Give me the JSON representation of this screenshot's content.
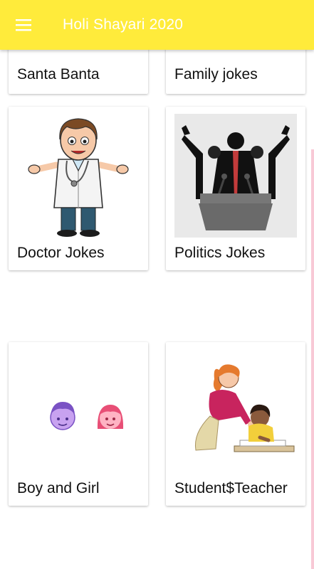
{
  "app": {
    "title": "Holi Shayari 2020",
    "accent_color": "#ffeb3b"
  },
  "toolbar": {
    "menu_icon": "hamburger-menu-icon"
  },
  "categories": [
    {
      "label": "Santa Banta",
      "icon": "none"
    },
    {
      "label": "Family jokes",
      "icon": "none"
    },
    {
      "label": "Doctor Jokes",
      "icon": "doctor-cartoon-icon"
    },
    {
      "label": "Politics Jokes",
      "icon": "politician-podium-icon"
    },
    {
      "label": "Boy and Girl",
      "icon": "boy-girl-faces-icon"
    },
    {
      "label": "Student$Teacher",
      "icon": "teacher-student-icon"
    }
  ]
}
